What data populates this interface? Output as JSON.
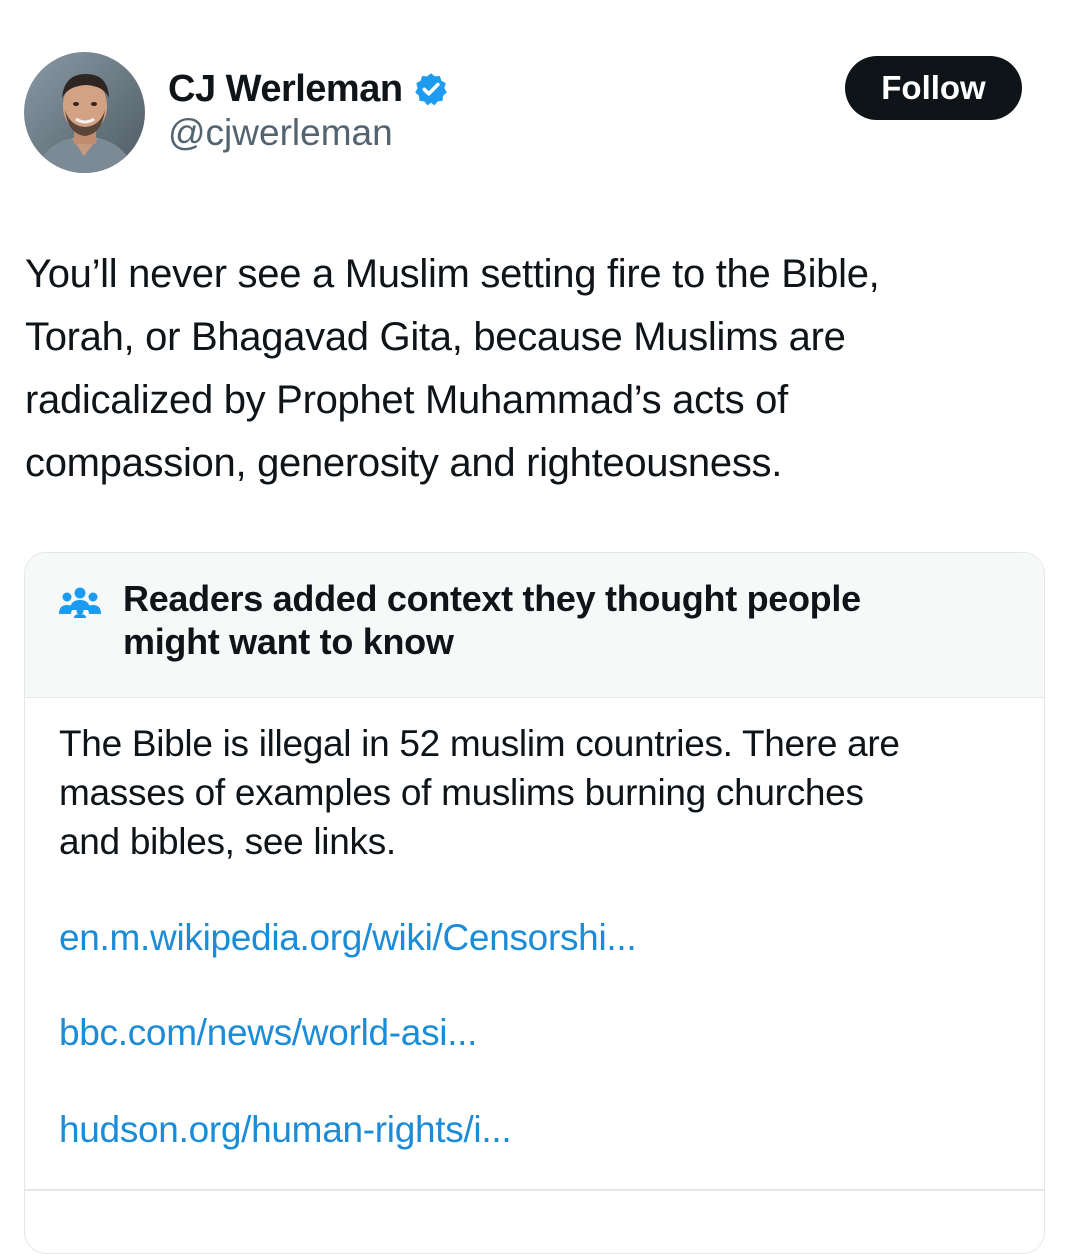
{
  "author": {
    "display_name": "CJ Werleman",
    "handle": "@cjwerleman",
    "verified": true
  },
  "follow_button": {
    "label": "Follow"
  },
  "tweet": {
    "text": "You’ll never see a Muslim setting fire to the Bible,\nTorah, or Bhagavad Gita, because Muslims are\nradicalized by Prophet Muhammad’s acts of\ncompassion, generosity and righteousness."
  },
  "community_note": {
    "header": "Readers added context they thought people\nmight want to know",
    "body": "The Bible is illegal in 52 muslim countries. There are\nmasses of examples of muslims burning churches\nand bibles, see links.",
    "links": [
      "en.m.wikipedia.org/wiki/Censorshi...",
      "bbc.com/news/world-asi...",
      "hudson.org/human-rights/i..."
    ]
  },
  "icons": {
    "verified": "verified-badge-icon",
    "people": "people-icon"
  },
  "colors": {
    "verified_blue": "#1d9bf0",
    "link_blue": "#1a8cd8",
    "text_primary": "#0f1419",
    "text_secondary": "#536471",
    "note_header_bg": "#f7f9f9",
    "border": "#e3e7ea"
  }
}
